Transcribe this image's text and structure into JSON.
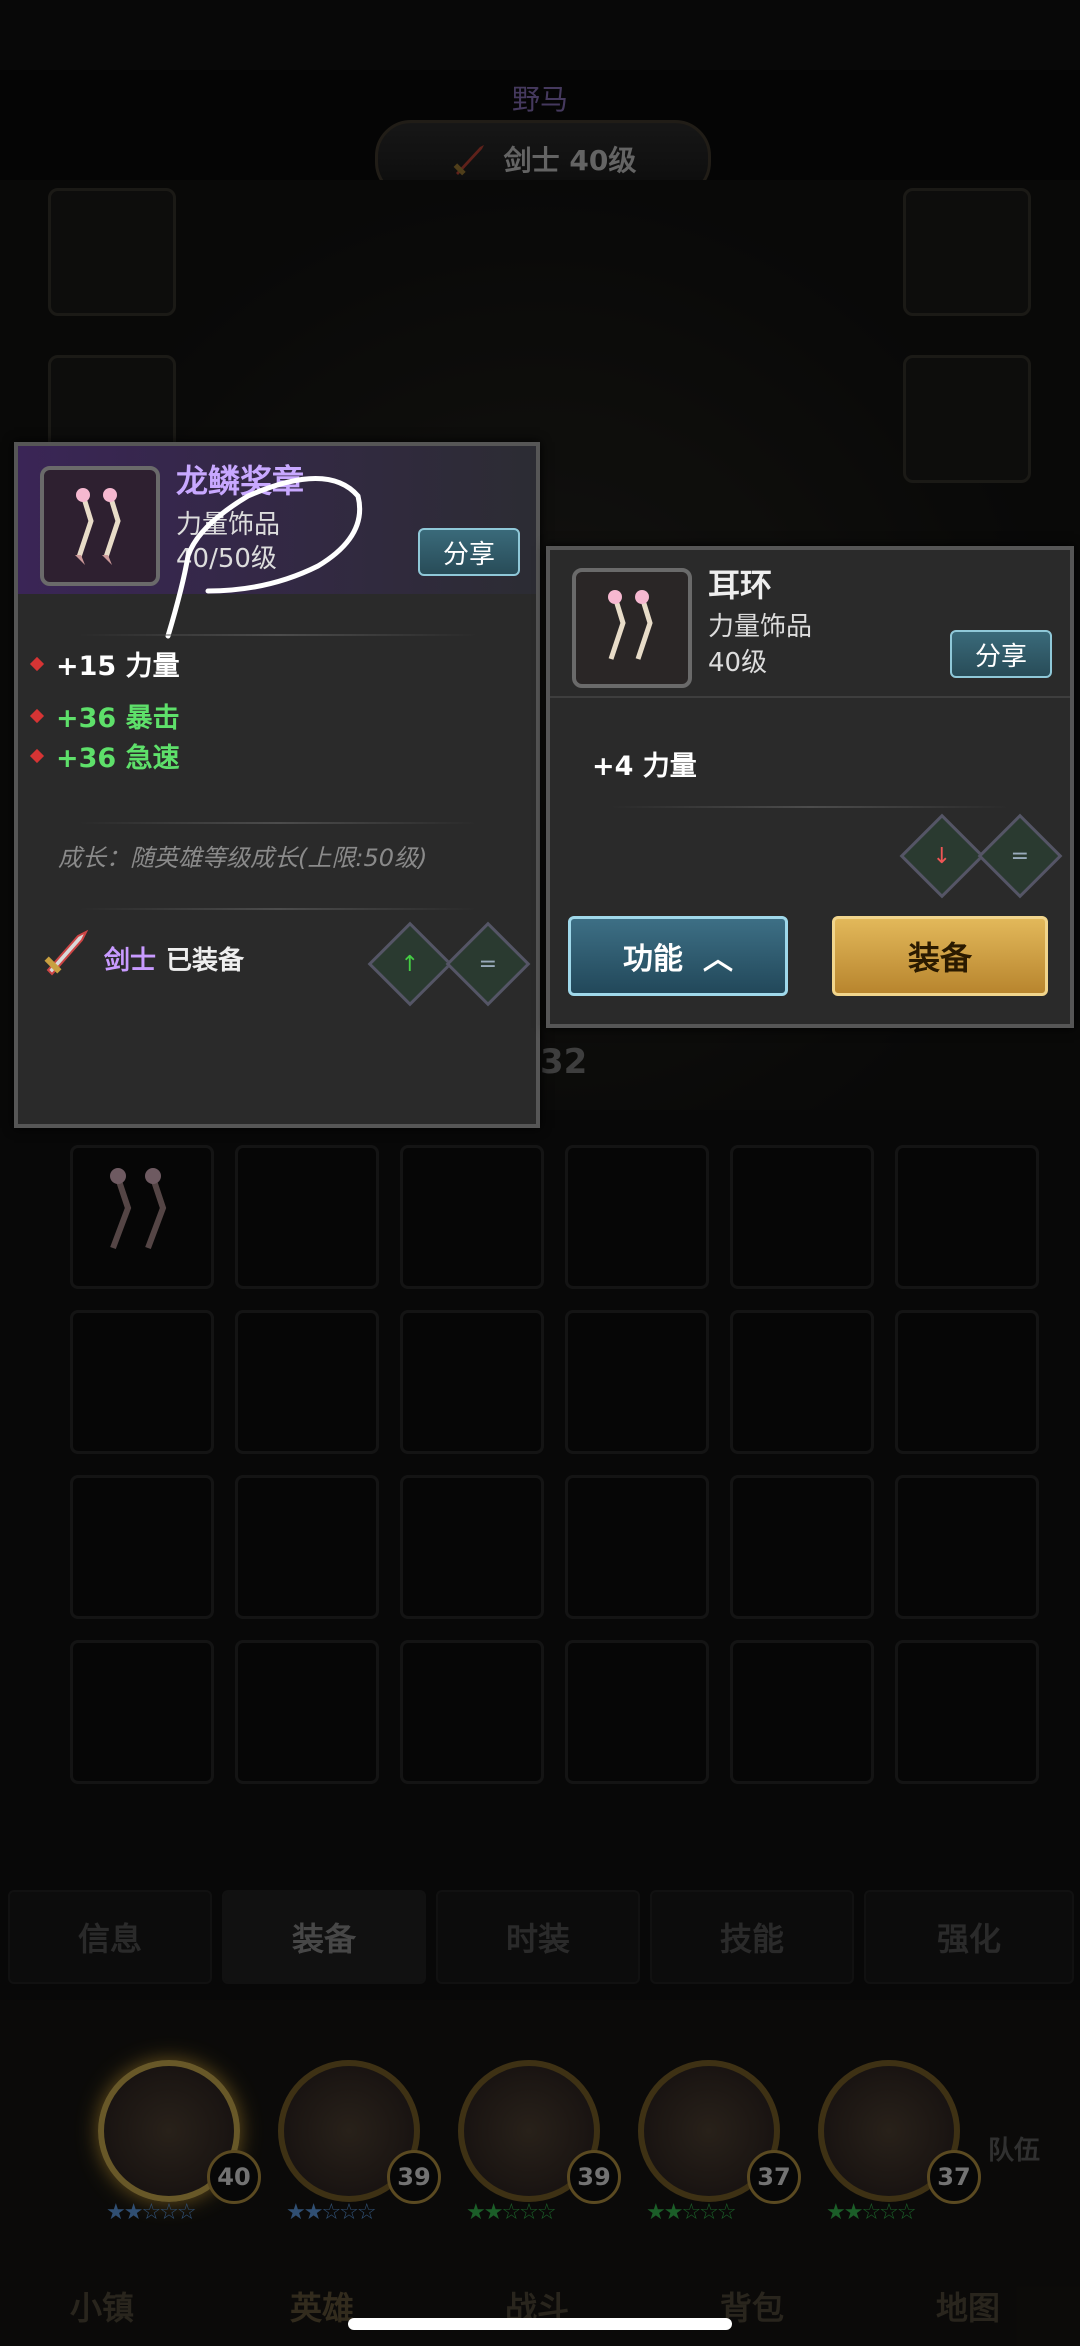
{
  "header": {
    "title": "野马",
    "class_level": "剑士 40级"
  },
  "equipped_item": {
    "name": "龙鳞奖章",
    "type": "力量饰品",
    "level": "40/50级",
    "share": "分享",
    "stats": [
      "+15 力量",
      "+36 暴击",
      "+36 急速"
    ],
    "growth": "成长：随英雄等级成长(上限:50级)",
    "equipped_class": "剑士",
    "equipped_label": "已装备"
  },
  "compare_item": {
    "name": "耳环",
    "type": "力量饰品",
    "level": "40级",
    "share": "分享",
    "stats": [
      "+4 力量"
    ],
    "func_button": "功能",
    "equip_button": "装备"
  },
  "behind_value": "32",
  "tabs": [
    "信息",
    "装备",
    "时装",
    "技能",
    "强化"
  ],
  "heroes": [
    {
      "level": "40"
    },
    {
      "level": "39"
    },
    {
      "level": "39"
    },
    {
      "level": "37"
    },
    {
      "level": "37"
    }
  ],
  "team_label": "队伍",
  "nav": [
    "小镇",
    "英雄",
    "战斗",
    "背包",
    "地图"
  ]
}
